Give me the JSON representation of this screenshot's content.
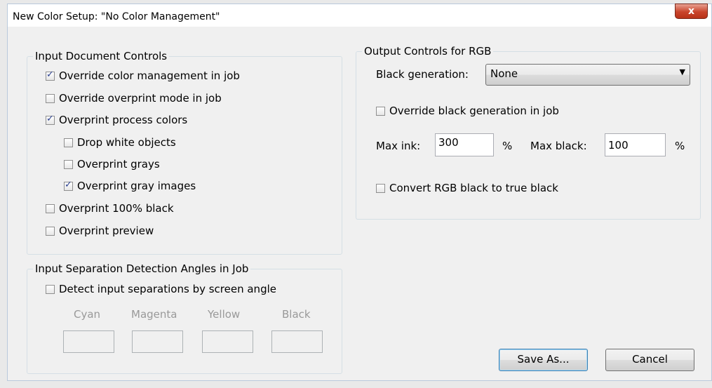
{
  "window": {
    "title": "New Color Setup: \"No Color Management\"",
    "close_label": "x"
  },
  "input_controls": {
    "legend": "Input Document Controls",
    "items": [
      {
        "label": "Override color management in job",
        "checked": true
      },
      {
        "label": "Override overprint mode in job",
        "checked": false
      },
      {
        "label": "Overprint process colors",
        "checked": true
      },
      {
        "label": "Drop white objects",
        "checked": false
      },
      {
        "label": "Overprint grays",
        "checked": false
      },
      {
        "label": "Overprint gray images",
        "checked": true
      },
      {
        "label": "Overprint 100% black",
        "checked": false
      },
      {
        "label": "Overprint preview",
        "checked": false
      }
    ]
  },
  "separation": {
    "legend": "Input Separation Detection Angles in Job",
    "detect_label": "Detect input separations by screen angle",
    "detect_checked": false,
    "colors": [
      "Cyan",
      "Magenta",
      "Yellow",
      "Black"
    ],
    "values": [
      "",
      "",
      "",
      ""
    ]
  },
  "output": {
    "legend": "Output Controls for RGB",
    "black_gen_label": "Black generation:",
    "black_gen_value": "None",
    "override_label": "Override black generation in job",
    "override_checked": false,
    "max_ink_label": "Max ink:",
    "max_ink_value": "300",
    "max_ink_unit": "%",
    "max_black_label": "Max black:",
    "max_black_value": "100",
    "max_black_unit": "%",
    "convert_label": "Convert RGB black to true black",
    "convert_checked": false
  },
  "buttons": {
    "save_as": "Save As...",
    "cancel": "Cancel"
  }
}
